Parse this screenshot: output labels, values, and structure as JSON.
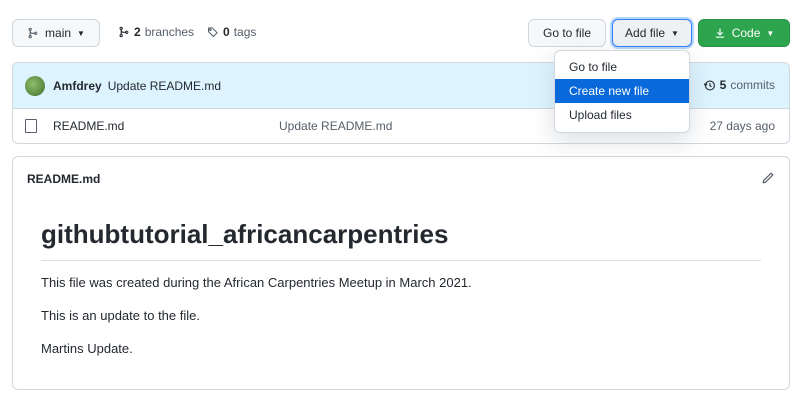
{
  "toolbar": {
    "branch_label": "main",
    "branches_count": "2",
    "branches_label": "branches",
    "tags_count": "0",
    "tags_label": "tags",
    "go_to_file_label": "Go to file",
    "add_file_label": "Add file",
    "code_label": "Code"
  },
  "add_file_menu": {
    "items": [
      {
        "label": "Go to file"
      },
      {
        "label": "Create new file"
      },
      {
        "label": "Upload files"
      }
    ],
    "active_index": 1
  },
  "latest_commit": {
    "author": "Amfdrey",
    "message": "Update README.md",
    "commits_count": "5",
    "commits_label": "commits"
  },
  "files": [
    {
      "name": "README.md",
      "last_commit": "Update README.md",
      "age": "27 days ago"
    }
  ],
  "readme": {
    "file_label": "README.md",
    "heading": "githubtutorial_africancarpentries",
    "paragraphs": [
      "This file was created during the African Carpentries Meetup in March 2021.",
      "This is an update to the file.",
      "Martins Update."
    ]
  },
  "colors": {
    "accent": "#0969da",
    "code_button": "#2da44e",
    "commit_header_bg": "#ddf4ff"
  },
  "icons": [
    "branch-icon",
    "tag-icon",
    "download-icon",
    "history-icon",
    "file-icon",
    "pencil-icon"
  ]
}
